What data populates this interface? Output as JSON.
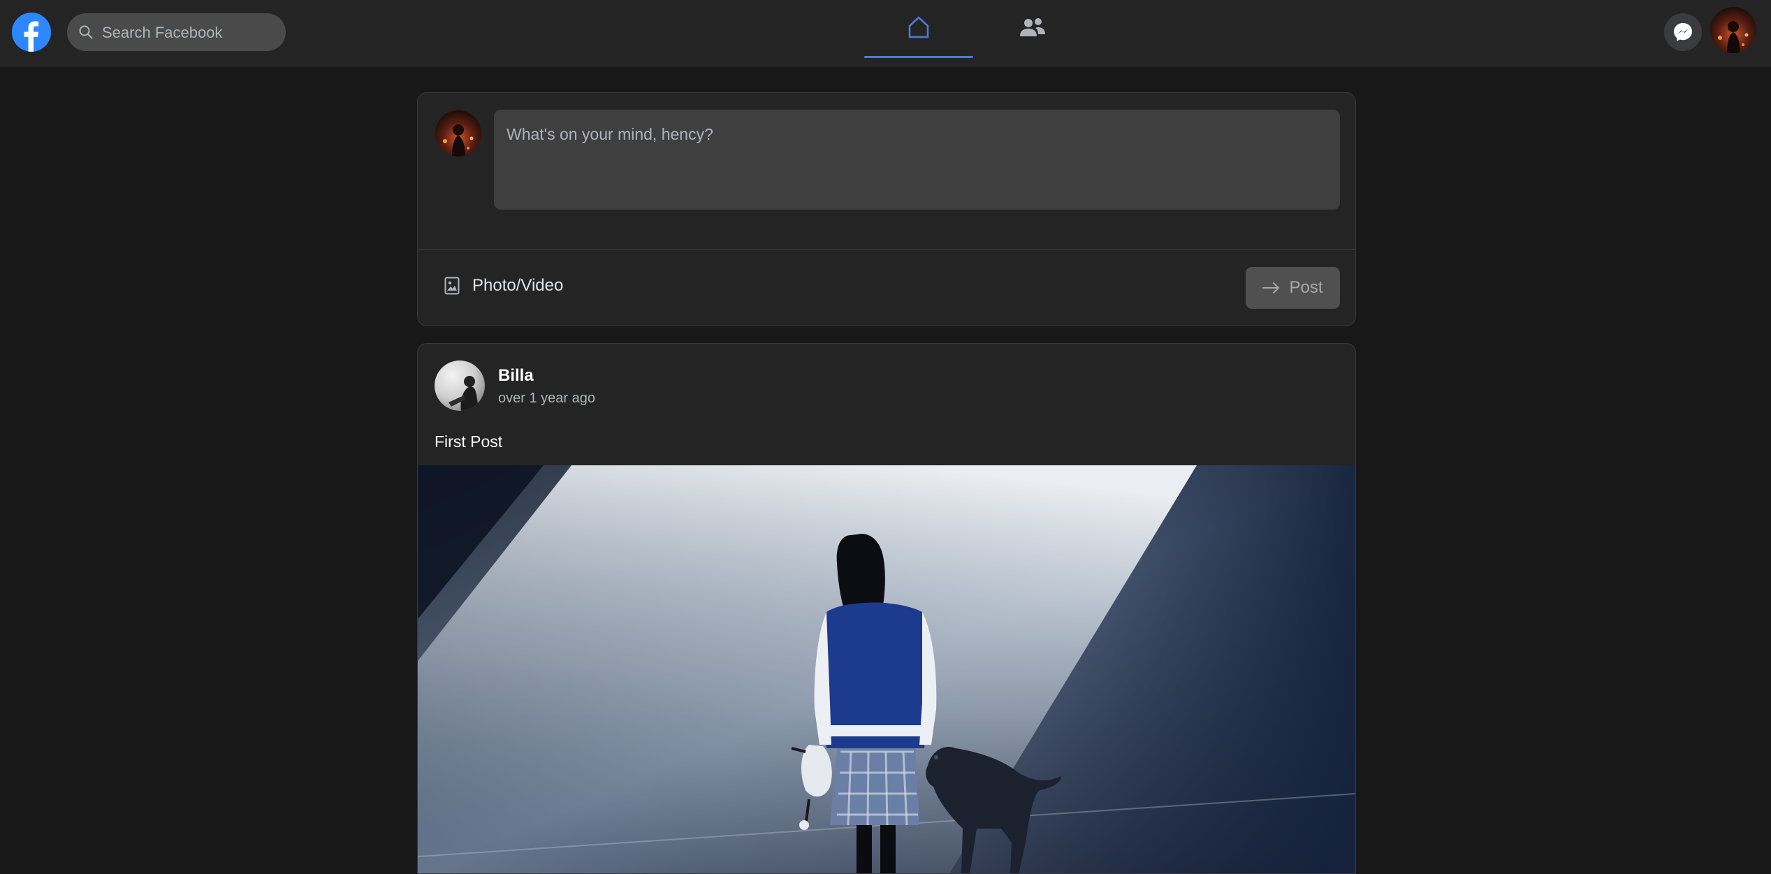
{
  "header": {
    "search_placeholder": "Search Facebook",
    "icons": {
      "logo": "facebook-logo-icon",
      "search": "search-icon",
      "home": "home-icon",
      "friends": "friends-icon",
      "messenger": "messenger-icon"
    },
    "active_tab": "home"
  },
  "composer": {
    "placeholder": "What's on your mind, hency?",
    "photo_label": "Photo/Video",
    "post_label": "Post"
  },
  "post": {
    "author": "Billa",
    "time": "over 1 year ago",
    "text": "First Post"
  },
  "colors": {
    "brand": "#2d88ff",
    "active_tab": "#4c7bd9",
    "background": "#181818",
    "surface": "#242424"
  }
}
